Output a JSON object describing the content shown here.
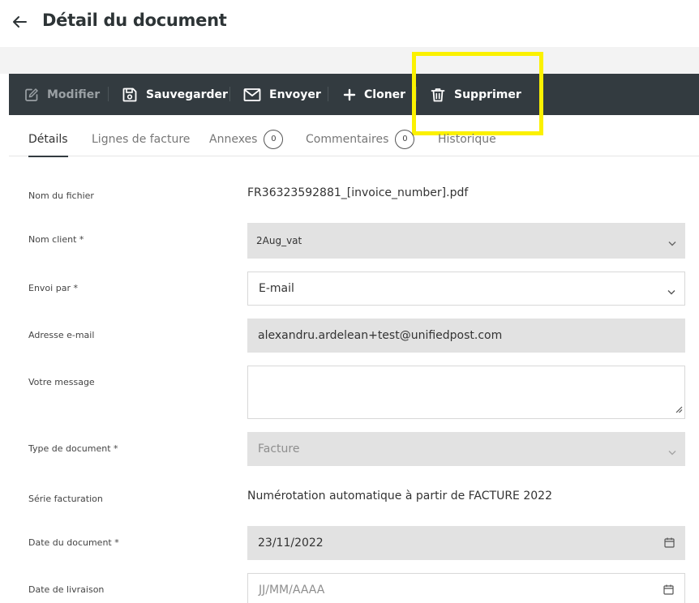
{
  "header": {
    "title": "Détail du document"
  },
  "toolbar": {
    "modifier": "Modifier",
    "sauvegarder": "Sauvegarder",
    "envoyer": "Envoyer",
    "cloner": "Cloner",
    "supprimer": "Supprimer"
  },
  "tabs": {
    "details": "Détails",
    "lignes": "Lignes de facture",
    "annexes": "Annexes",
    "annexes_count": "0",
    "commentaires": "Commentaires",
    "commentaires_count": "0",
    "historique": "Historique"
  },
  "form": {
    "nom_fichier": {
      "label": "Nom du fichier",
      "value": "FR36323592881_[invoice_number].pdf"
    },
    "nom_client": {
      "label": "Nom client *",
      "value": "2Aug_vat"
    },
    "envoi_par": {
      "label": "Envoi par *",
      "value": "E-mail"
    },
    "adresse_email": {
      "label": "Adresse e-mail",
      "value": "alexandru.ardelean+test@unifiedpost.com"
    },
    "votre_message": {
      "label": "Votre message",
      "value": ""
    },
    "type_document": {
      "label": "Type de document *",
      "value": "Facture"
    },
    "serie": {
      "label": "Série facturation",
      "value": "Numérotation automatique à partir de FACTURE 2022"
    },
    "date_document": {
      "label": "Date du document *",
      "value": "23/11/2022"
    },
    "date_livraison": {
      "label": "Date de livraison",
      "placeholder": "JJ/MM/AAAA"
    }
  },
  "colors": {
    "toolbar_bg": "#333b40",
    "highlight": "#fbf100",
    "field_grey": "#e2e2e2",
    "band_grey": "#f3f3f3"
  },
  "icons": {
    "back": "arrow-left-icon",
    "modifier": "edit-icon",
    "sauvegarder": "save-icon",
    "envoyer": "mail-icon",
    "cloner": "plus-icon",
    "supprimer": "trash-icon",
    "select": "chevron-down-icon",
    "date": "calendar-icon"
  }
}
